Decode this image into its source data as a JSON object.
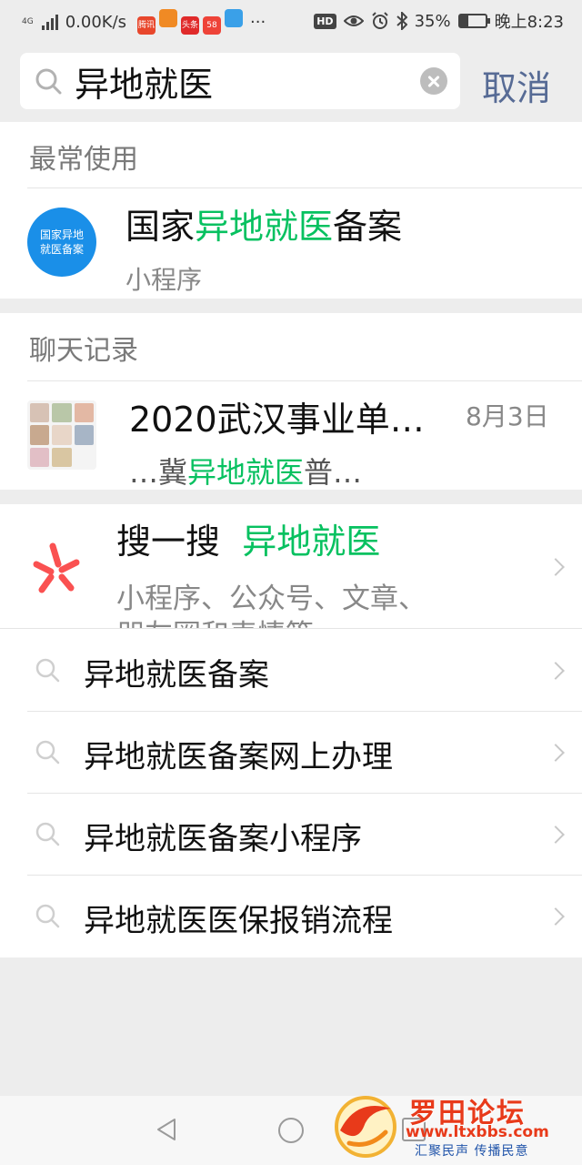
{
  "status_bar": {
    "network_type": "4G",
    "speed": "0.00K/s",
    "app_icons": [
      {
        "name": "tengxun-app-icon",
        "label": "腾讯",
        "color": "#e8472c"
      },
      {
        "name": "flower-app-icon",
        "label": "",
        "color": "#f08a24"
      },
      {
        "name": "toutiao-app-icon",
        "label": "头条",
        "color": "#e02a2a"
      },
      {
        "name": "58-app-icon",
        "label": "58",
        "color": "#ee4338"
      },
      {
        "name": "browser-app-icon",
        "label": "",
        "color": "#3aa0e8"
      }
    ],
    "more": "···",
    "hd": "HD",
    "battery": "35%",
    "battery_level": 0.35,
    "time": "晚上8:23"
  },
  "search": {
    "value": "异地就医",
    "cancel_label": "取消"
  },
  "most_used": {
    "title": "最常使用",
    "item": {
      "logo_line1": "国家异地",
      "logo_line2": "就医备案",
      "title_prefix": "国家",
      "title_highlight": "异地就医",
      "title_suffix": "备案",
      "subtitle": "小程序"
    }
  },
  "chat_history": {
    "title": "聊天记录",
    "item": {
      "title": "2020武汉事业单…",
      "date": "8月3日",
      "snippet_prefix": "…冀",
      "snippet_highlight": "异地就医",
      "snippet_suffix": "普…"
    }
  },
  "souyisou": {
    "label": "搜一搜",
    "keyword": "异地就医",
    "desc": "小程序、公众号、文章、",
    "desc_cut": "朋友圈和表情等"
  },
  "suggestions": [
    "异地就医备案",
    "异地就医备案网上办理",
    "异地就医备案小程序",
    "异地就医医保报销流程"
  ],
  "watermark": {
    "title": "罗田论坛",
    "url": "www.ltxbbs.com",
    "slogan": "汇聚民声  传播民意"
  },
  "colors": {
    "highlight": "#07c160",
    "link": "#576b95",
    "background": "#ededed"
  }
}
